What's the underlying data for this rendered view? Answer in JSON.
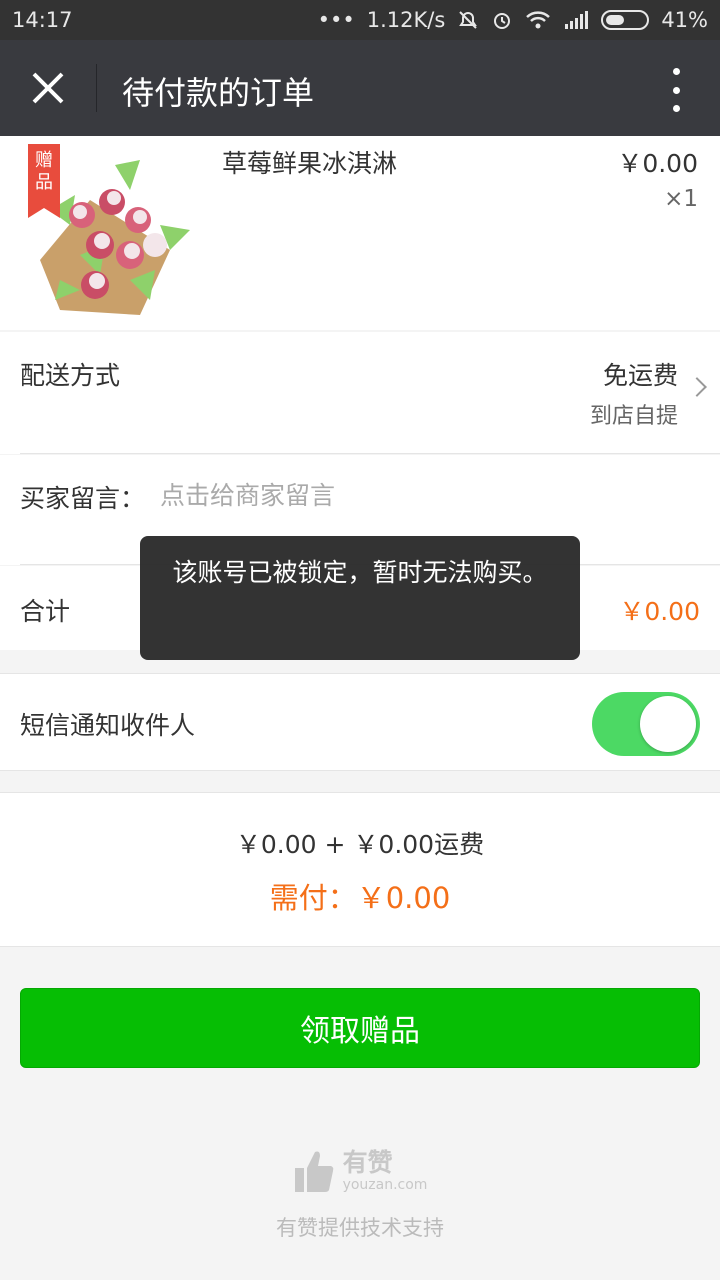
{
  "status_bar": {
    "time": "14:17",
    "dots": "•••",
    "network_speed": "1.12K/s",
    "battery": "41%"
  },
  "nav": {
    "title": "待付款的订单",
    "close_icon": "close-icon",
    "more_icon": "more-vertical-icon"
  },
  "product": {
    "tag": "赠品",
    "name": "草莓鲜果冰淇淋",
    "price": "￥0.00",
    "quantity": "×1"
  },
  "delivery": {
    "label": "配送方式",
    "fee": "免运费",
    "mode": "到店自提"
  },
  "message": {
    "label": "买家留言：",
    "placeholder": "点击给商家留言",
    "value": ""
  },
  "total": {
    "label": "合计",
    "value": "￥0.00"
  },
  "sms": {
    "label": "短信通知收件人",
    "enabled": true
  },
  "summary": {
    "line": "￥0.00 + ￥0.00运费",
    "due": "需付：￥0.00"
  },
  "cta": {
    "label": "领取赠品"
  },
  "footer": {
    "logo_cn": "有赞",
    "logo_en": "youzan.com",
    "support": "有赞提供技术支持"
  },
  "toast": {
    "message": "该账号已被锁定，暂时无法购买。"
  },
  "colors": {
    "accent_orange": "#f46f18",
    "cta_green": "#06be04",
    "toggle_green": "#4cd964",
    "nav_bg": "#393a3f",
    "gift_tag_red": "#e84c3d"
  }
}
